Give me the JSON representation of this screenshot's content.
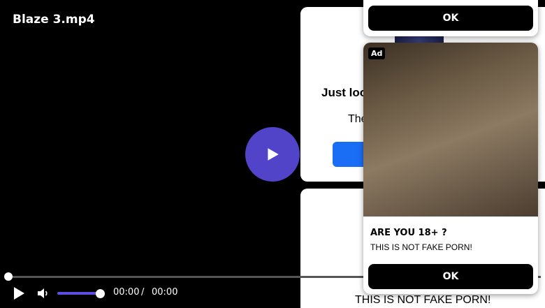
{
  "player": {
    "title": "Blaze 3.mp4",
    "current_time": "00:00",
    "separator": "/",
    "duration": "00:00",
    "progress": 0,
    "volume": 1.0,
    "accent_color": "#5144c8"
  },
  "icons": {
    "big_play": "play-icon",
    "ctrl_play": "play-icon",
    "volume": "volume-icon"
  },
  "card_1": {
    "headline": "Just loo",
    "subtext": "The"
  },
  "card_2": {
    "bottom_text": "THIS IS NOT FAKE PORN!"
  },
  "popup_top": {
    "ok_label": "OK"
  },
  "popup_ad": {
    "badge": "Ad",
    "heading": "ARE YOU 18+ ?",
    "text": "THIS IS NOT FAKE PORN!",
    "ok_label": "OK"
  }
}
